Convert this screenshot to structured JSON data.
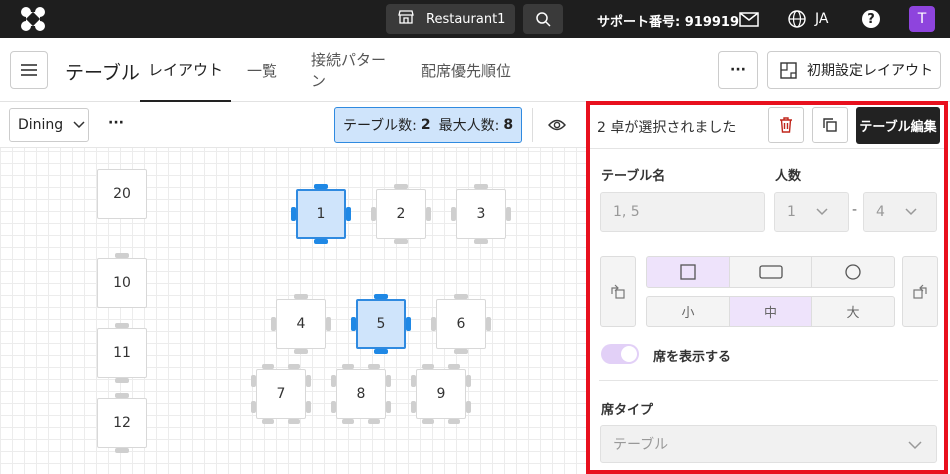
{
  "topbar": {
    "restaurant": "Restaurant1",
    "support_label": "サポート番号: 919919",
    "lang": "JA",
    "avatar": "T",
    "icons": [
      "logo-icon",
      "shop-icon",
      "search-icon",
      "mail-icon",
      "globe-icon",
      "help-icon"
    ]
  },
  "tabs": {
    "page_title": "テーブル",
    "items": [
      {
        "label": "レイアウト",
        "active": true
      },
      {
        "label": "一覧",
        "active": false
      },
      {
        "label": "接続パターン",
        "active": false
      },
      {
        "label": "配席優先順位",
        "active": false
      }
    ],
    "more_label": "···",
    "initial_layout_label": "初期設定レイアウト"
  },
  "toolbar": {
    "area": "Dining",
    "more": "···",
    "table_count_label": "テーブル数:",
    "table_count": "2",
    "max_people_label": "最大人数:",
    "max_people": "8"
  },
  "tables": [
    {
      "label": "20",
      "selected": false
    },
    {
      "label": "10",
      "selected": false
    },
    {
      "label": "11",
      "selected": false
    },
    {
      "label": "12",
      "selected": false
    },
    {
      "label": "1",
      "selected": true
    },
    {
      "label": "2",
      "selected": false
    },
    {
      "label": "3",
      "selected": false
    },
    {
      "label": "4",
      "selected": false
    },
    {
      "label": "5",
      "selected": true
    },
    {
      "label": "6",
      "selected": false
    },
    {
      "label": "7",
      "selected": false
    },
    {
      "label": "8",
      "selected": false
    },
    {
      "label": "9",
      "selected": false
    }
  ],
  "panel": {
    "selection_text": "2 卓が選択されました",
    "edit_button": "テーブル編集",
    "table_name_label": "テーブル名",
    "table_name_value": "1, 5",
    "people_label": "人数",
    "people_min": "1",
    "people_sep": "-",
    "people_max": "4",
    "size_options": [
      "小",
      "中",
      "大"
    ],
    "size_selected": "中",
    "show_seats_label": "席を表示する",
    "seat_type_label": "席タイプ",
    "seat_type_value": "テーブル"
  },
  "colors": {
    "accent": "#2f8ae0",
    "purple": "#8e44dd",
    "highlight_box": "#e8101d"
  }
}
